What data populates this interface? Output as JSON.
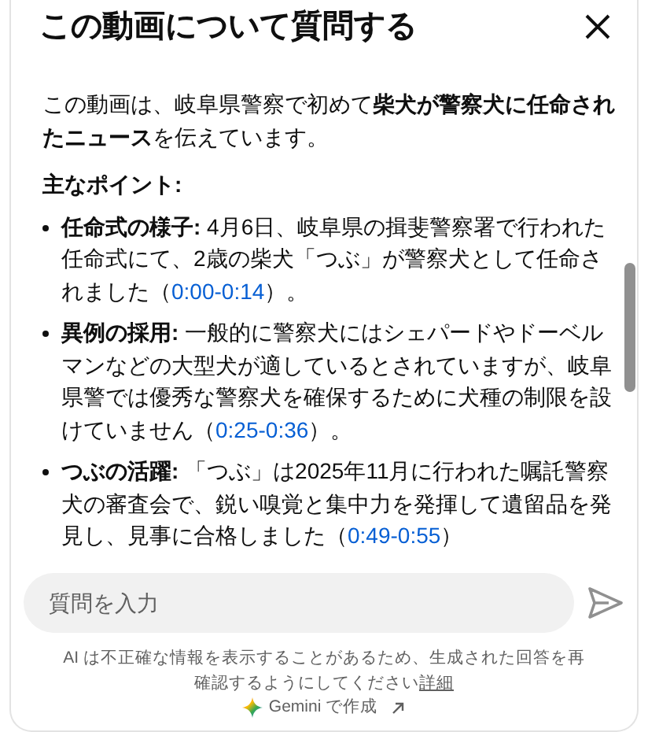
{
  "dialog": {
    "title": "この動画について質問する"
  },
  "summary": {
    "intro": "この動画は、岐阜県警察で初めて**柴犬が警察犬に任命されたニュース**を伝えています。",
    "heading": "主なポイント:",
    "points": [
      {
        "text": "**任命式の様子:** 4月6日、岐阜県の揖斐警察署で行われた任命式にて、2歳の柴犬「つぶ」が警察犬として任命されました（",
        "timestamp": "0:00-0:14",
        "after": "）。"
      },
      {
        "text": "**異例の採用:** 一般的に警察犬にはシェパードやドーベルマンなどの大型犬が適しているとされていますが、岐阜県警では優秀な警察犬を確保するために犬種の制限を設けていません（",
        "timestamp": "0:25-0:36",
        "after": "）。"
      },
      {
        "text": "**つぶの活躍:** 「つぶ」は2025年11月に行われた嘱託警察犬の審査会で、鋭い嗅覚と集中力を発揮して遺留品を発見し、見事に合格しました（",
        "timestamp": "0:49-0:55",
        "after": "）"
      }
    ]
  },
  "input": {
    "placeholder": "質問を入力"
  },
  "disclaimer": {
    "text": "AI は不正確な情報を表示することがあるため、生成された回答を再確認するようにしてください",
    "link": "詳細"
  },
  "credit": {
    "text": "Gemini で作成"
  }
}
